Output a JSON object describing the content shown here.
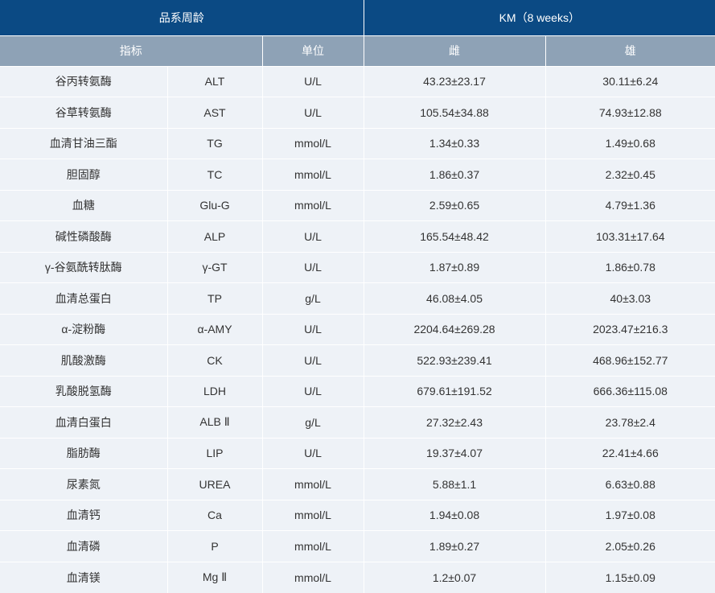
{
  "colors": {
    "header_bg": "#0b4a84",
    "subheader_bg": "#8ea2b6",
    "row_bg": "#eef2f7",
    "text": "#333333",
    "header_text": "#ffffff"
  },
  "header": {
    "group_label": "品系周龄",
    "strain_label": "KM（8 weeks）",
    "col_indicator": "指标",
    "col_unit": "单位",
    "col_female": "雌",
    "col_male": "雄"
  },
  "rows": [
    {
      "name": "谷丙转氨酶",
      "abbr": "ALT",
      "unit": "U/L",
      "female": "43.23±23.17",
      "male": "30.11±6.24"
    },
    {
      "name": "谷草转氨酶",
      "abbr": "AST",
      "unit": "U/L",
      "female": "105.54±34.88",
      "male": "74.93±12.88"
    },
    {
      "name": "血清甘油三酯",
      "abbr": "TG",
      "unit": "mmol/L",
      "female": "1.34±0.33",
      "male": "1.49±0.68"
    },
    {
      "name": "胆固醇",
      "abbr": "TC",
      "unit": "mmol/L",
      "female": "1.86±0.37",
      "male": "2.32±0.45"
    },
    {
      "name": "血糖",
      "abbr": "Glu-G",
      "unit": "mmol/L",
      "female": "2.59±0.65",
      "male": "4.79±1.36"
    },
    {
      "name": "碱性磷酸酶",
      "abbr": "ALP",
      "unit": "U/L",
      "female": "165.54±48.42",
      "male": "103.31±17.64"
    },
    {
      "name": "γ-谷氨酰转肽酶",
      "abbr": "γ-GT",
      "unit": "U/L",
      "female": "1.87±0.89",
      "male": "1.86±0.78"
    },
    {
      "name": "血清总蛋白",
      "abbr": "TP",
      "unit": "g/L",
      "female": "46.08±4.05",
      "male": "40±3.03"
    },
    {
      "name": "α-淀粉酶",
      "abbr": "α-AMY",
      "unit": "U/L",
      "female": "2204.64±269.28",
      "male": "2023.47±216.3"
    },
    {
      "name": "肌酸激酶",
      "abbr": "CK",
      "unit": "U/L",
      "female": "522.93±239.41",
      "male": "468.96±152.77"
    },
    {
      "name": "乳酸脱氢酶",
      "abbr": "LDH",
      "unit": "U/L",
      "female": "679.61±191.52",
      "male": "666.36±115.08"
    },
    {
      "name": "血清白蛋白",
      "abbr": "ALB Ⅱ",
      "unit": "g/L",
      "female": "27.32±2.43",
      "male": "23.78±2.4"
    },
    {
      "name": "脂肪酶",
      "abbr": "LIP",
      "unit": "U/L",
      "female": "19.37±4.07",
      "male": "22.41±4.66"
    },
    {
      "name": "尿素氮",
      "abbr": "UREA",
      "unit": "mmol/L",
      "female": "5.88±1.1",
      "male": "6.63±0.88"
    },
    {
      "name": "血清钙",
      "abbr": "Ca",
      "unit": "mmol/L",
      "female": "1.94±0.08",
      "male": "1.97±0.08"
    },
    {
      "name": "血清磷",
      "abbr": "P",
      "unit": "mmol/L",
      "female": "1.89±0.27",
      "male": "2.05±0.26"
    },
    {
      "name": "血清镁",
      "abbr": "Mg Ⅱ",
      "unit": "mmol/L",
      "female": "1.2±0.07",
      "male": "1.15±0.09"
    }
  ]
}
